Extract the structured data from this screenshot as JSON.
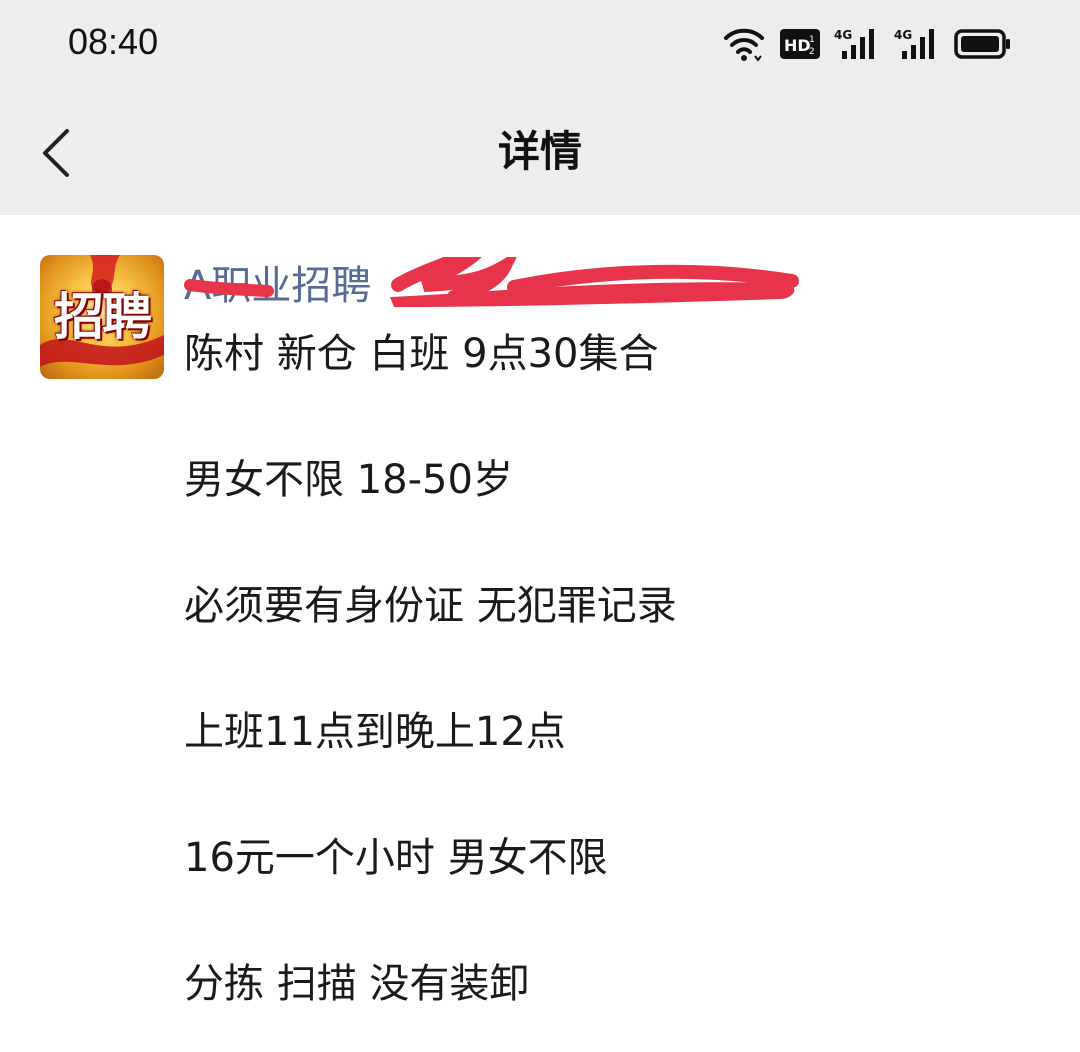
{
  "status_bar": {
    "time": "08:40",
    "icons": [
      "wifi-icon",
      "hd-icon",
      "signal-4g-icon",
      "signal-4g-icon",
      "battery-icon"
    ],
    "hd_label": "HD",
    "network_label": "4G"
  },
  "header": {
    "title": "详情"
  },
  "post": {
    "avatar_text": "招聘",
    "sender_name": "A职业招聘",
    "lines": [
      "陈村 新仓 白班 9点30集合",
      "男女不限 18-50岁",
      "必须要有身份证 无犯罪记录",
      "上班11点到晚上12点",
      "16元一个小时 男女不限",
      "分拣 扫描 没有装卸"
    ]
  },
  "colors": {
    "header_bg": "#ededed",
    "page_bg": "#ffffff",
    "sender_name": "#586b95",
    "text": "#1a1a1a",
    "redaction": "#e8344a"
  }
}
